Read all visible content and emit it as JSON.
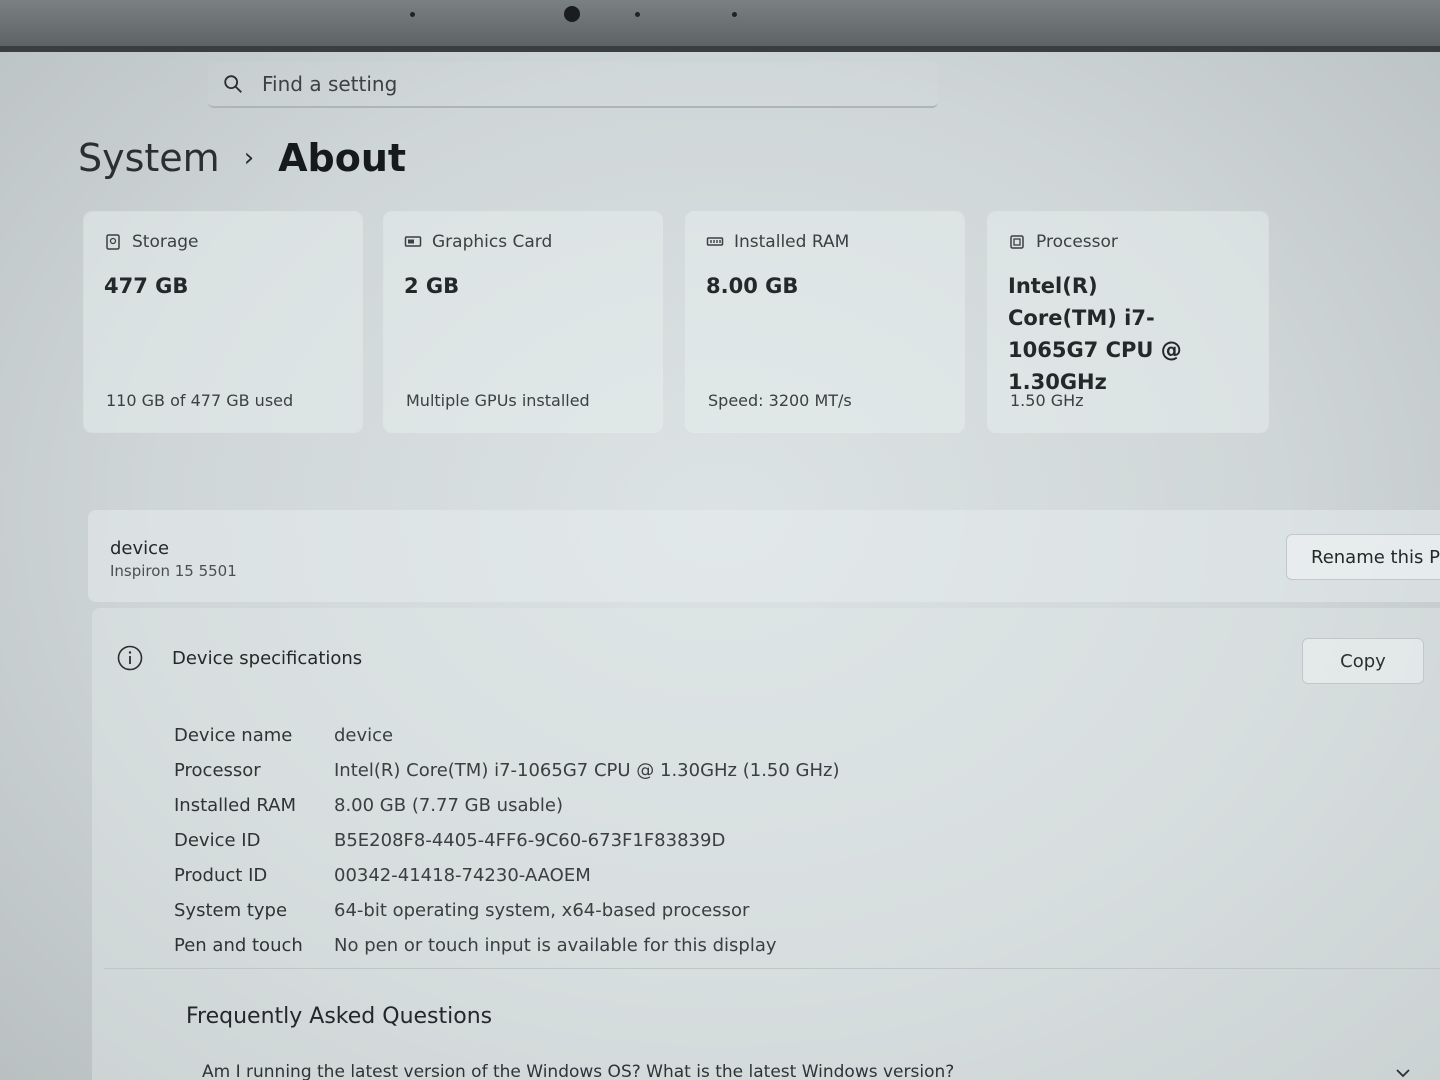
{
  "search": {
    "placeholder": "Find a setting"
  },
  "breadcrumb": {
    "parent": "System",
    "separator": "›",
    "current": "About"
  },
  "cards": [
    {
      "icon": "storage-icon",
      "label": "Storage",
      "value": "477 GB",
      "sub": "110 GB of 477 GB used"
    },
    {
      "icon": "graphics-card-icon",
      "label": "Graphics Card",
      "value": "2 GB",
      "sub": "Multiple GPUs installed"
    },
    {
      "icon": "ram-icon",
      "label": "Installed RAM",
      "value": "8.00 GB",
      "sub": "Speed: 3200 MT/s"
    },
    {
      "icon": "processor-icon",
      "label": "Processor",
      "value": "Intel(R) Core(TM) i7-1065G7 CPU @ 1.30GHz",
      "sub": "1.50 GHz"
    }
  ],
  "device": {
    "name": "device",
    "model": "Inspiron 15 5501",
    "rename_label": "Rename this PC"
  },
  "specs": {
    "title": "Device specifications",
    "copy_label": "Copy",
    "rows": [
      {
        "label": "Device name",
        "value": "device"
      },
      {
        "label": "Processor",
        "value": "Intel(R) Core(TM) i7-1065G7 CPU @ 1.30GHz (1.50 GHz)"
      },
      {
        "label": "Installed RAM",
        "value": "8.00 GB (7.77 GB usable)"
      },
      {
        "label": "Device ID",
        "value": "B5E208F8-4405-4FF6-9C60-673F1F83839D"
      },
      {
        "label": "Product ID",
        "value": "00342-41418-74230-AAOEM"
      },
      {
        "label": "System type",
        "value": "64-bit operating system, x64-based processor"
      },
      {
        "label": "Pen and touch",
        "value": "No pen or touch input is available for this display"
      }
    ]
  },
  "faq": {
    "title": "Frequently Asked Questions",
    "question": "Am I running the latest version of the Windows OS? What is the latest Windows version?"
  }
}
